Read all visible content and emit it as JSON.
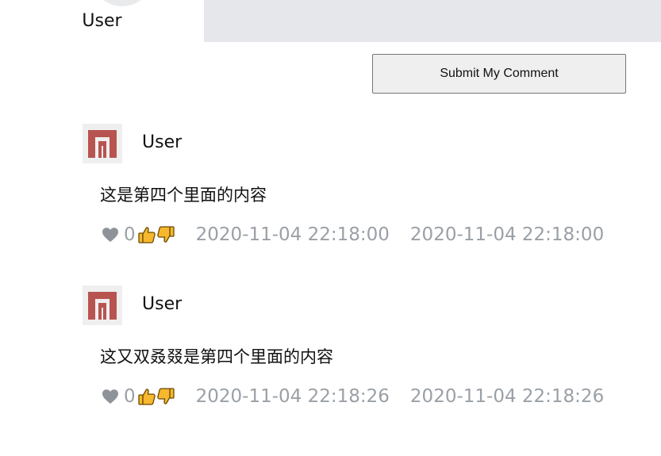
{
  "header": {
    "username": "User"
  },
  "actions": {
    "submit_label": "Submit My Comment"
  },
  "comments": [
    {
      "username": "User",
      "content": "这是第四个里面的内容",
      "likes": "0",
      "created": "2020-11-04 22:18:00",
      "updated": "2020-11-04 22:18:00"
    },
    {
      "username": "User",
      "content": "这又双叒叕是第四个里面的内容",
      "likes": "0",
      "created": "2020-11-04 22:18:26",
      "updated": "2020-11-04 22:18:26"
    }
  ],
  "icons": {
    "heart": "heart-icon",
    "thumbs_up": "thumbs-up-icon",
    "thumbs_down": "thumbs-down-icon",
    "avatar": "identicon-avatar"
  },
  "colors": {
    "avatar_fg": "#b85450",
    "avatar_bg": "#efefef",
    "meta_text": "#9aa0a6",
    "thumb_fill": "#f5b82e",
    "strip": "#e5e7ea"
  }
}
